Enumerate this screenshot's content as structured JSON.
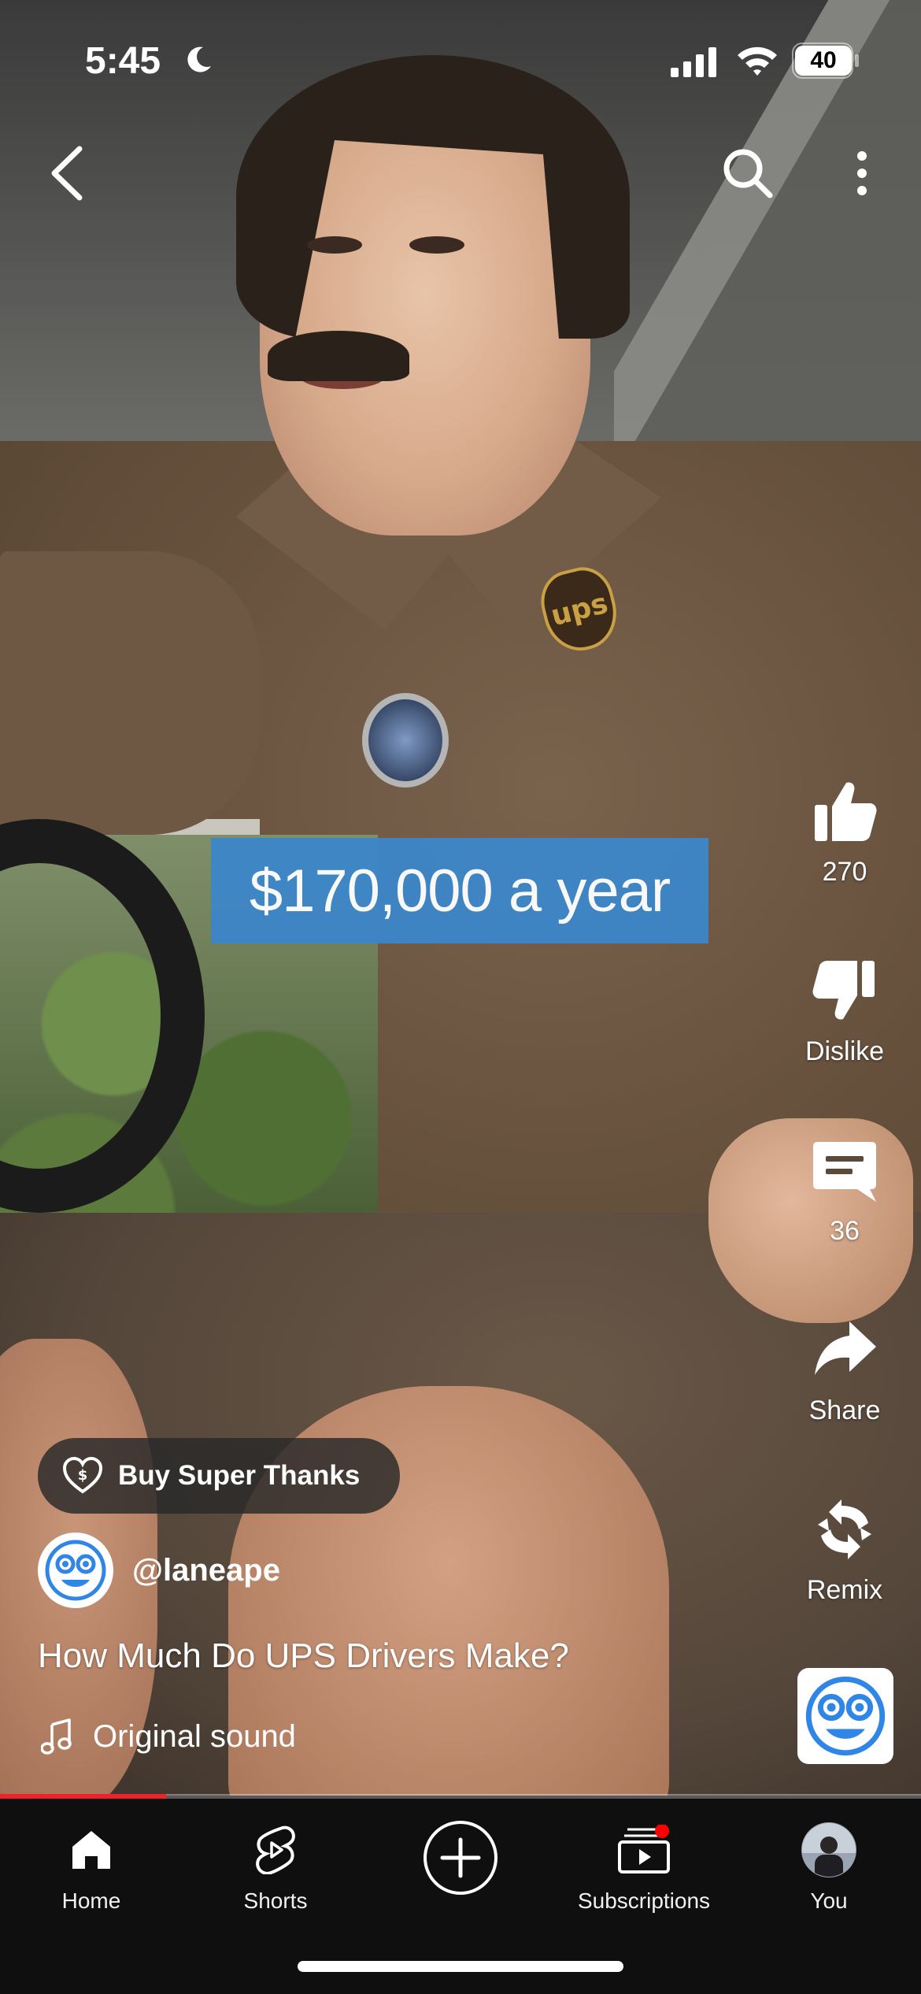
{
  "status_bar": {
    "time": "5:45",
    "battery": "40"
  },
  "video": {
    "caption": "$170,000 a year",
    "progress_fraction": 0.18
  },
  "actions": {
    "like_count": "270",
    "dislike_label": "Dislike",
    "comment_count": "36",
    "share_label": "Share",
    "remix_label": "Remix"
  },
  "info": {
    "super_thanks_label": "Buy Super Thanks",
    "channel_handle": "@laneape",
    "title": "How Much Do UPS Drivers Make?",
    "sound_label": "Original sound"
  },
  "nav": {
    "items": [
      {
        "label": "Home",
        "icon": "home-icon"
      },
      {
        "label": "Shorts",
        "icon": "shorts-icon"
      },
      {
        "label": "",
        "icon": "create-icon"
      },
      {
        "label": "Subscriptions",
        "icon": "subscriptions-icon"
      },
      {
        "label": "You",
        "icon": "avatar"
      }
    ]
  },
  "colors": {
    "caption_bg": "#3d86c8",
    "progress": "#e9252b",
    "notification_dot": "#ff0000",
    "nav_bg": "#0f0f0f"
  }
}
